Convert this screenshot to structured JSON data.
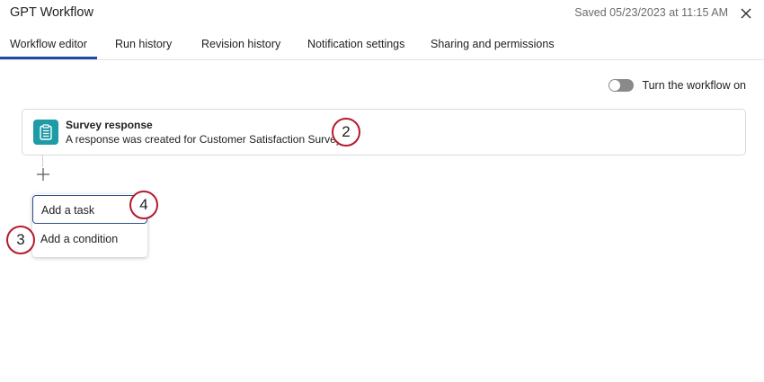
{
  "header": {
    "title": "GPT Workflow",
    "saved_status": "Saved 05/23/2023 at 11:15 AM",
    "close_icon": "close-icon"
  },
  "tabs": [
    {
      "label": "Workflow editor",
      "active": true
    },
    {
      "label": "Run history",
      "active": false
    },
    {
      "label": "Revision history",
      "active": false
    },
    {
      "label": "Notification settings",
      "active": false
    },
    {
      "label": "Sharing and permissions",
      "active": false
    }
  ],
  "workflow_toggle": {
    "label": "Turn the workflow on",
    "state": "off"
  },
  "trigger": {
    "icon": "clipboard-icon",
    "title": "Survey response",
    "description": "A response was created for Customer Satisfaction Survey"
  },
  "add_step_icon": "plus-icon",
  "add_menu": {
    "items": [
      {
        "label": "Add a task",
        "focused": true
      },
      {
        "label": "Add a condition",
        "focused": false
      }
    ]
  },
  "callouts": [
    "2",
    "3",
    "4"
  ],
  "colors": {
    "accent": "#1a4ba8",
    "trigger_icon_bg": "#1e9ba6",
    "callout_border": "#b31b2c",
    "toggle_off": "#8a8a8a"
  }
}
